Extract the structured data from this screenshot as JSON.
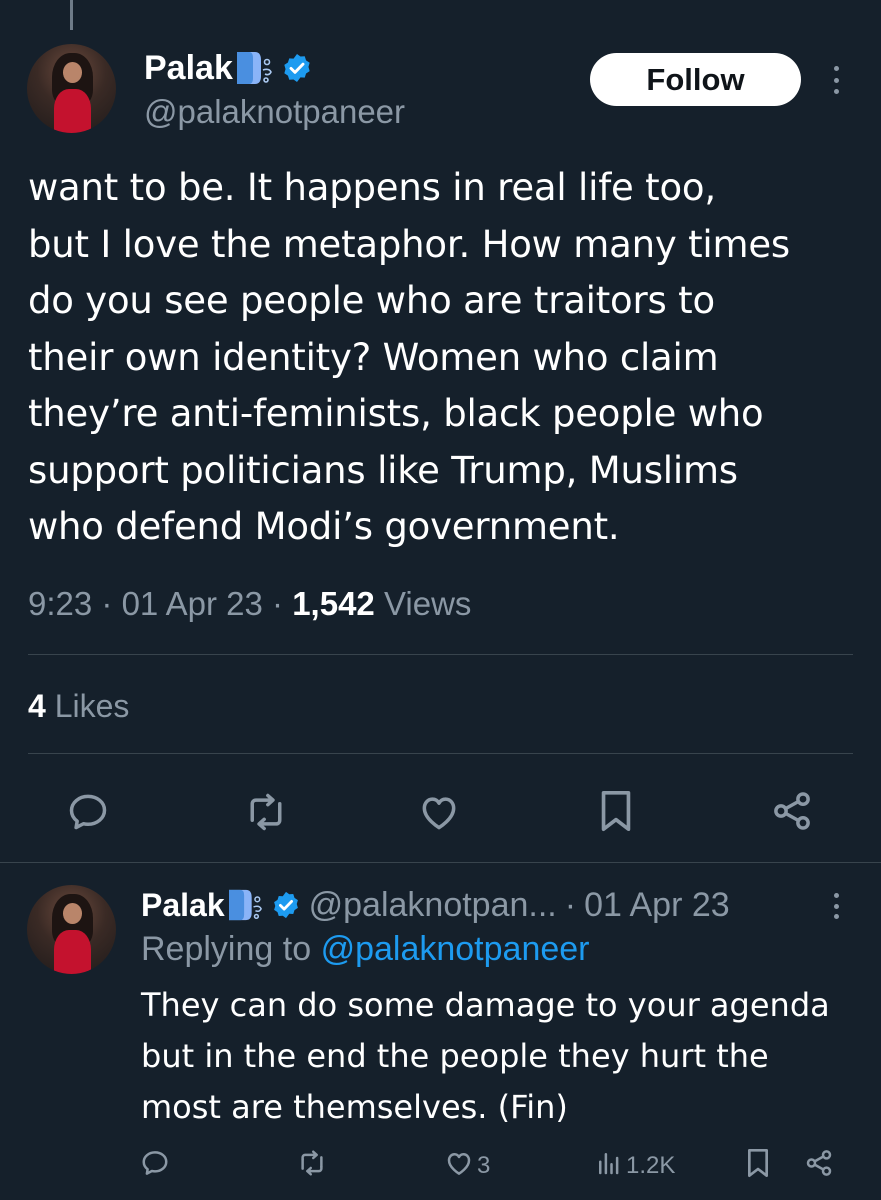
{
  "main_tweet": {
    "author": {
      "display_name": "Palak",
      "name_emoji": "face-exhaling-icon",
      "verified_icon": "verified-badge-icon",
      "handle": "@palaknotpaneer"
    },
    "follow_label": "Follow",
    "text": "want to be. It happens in real life too,\nbut I love the metaphor. How many times\ndo you see people who are traitors to\ntheir own identity? Women who claim\nthey’re anti-feminists, black people who\nsupport politicians like Trump, Muslims\nwho defend Modi’s government.",
    "time": "9:23",
    "date": "01 Apr 23",
    "separator": "·",
    "views_count": "1,542",
    "views_label": "Views",
    "likes_count": "4",
    "likes_label": "Likes",
    "actions": [
      "reply-icon",
      "retweet-icon",
      "like-icon",
      "bookmark-icon",
      "share-icon"
    ]
  },
  "reply_tweet": {
    "author": {
      "display_name": "Palak",
      "handle": "@palaknotpan...",
      "date": "01 Apr 23"
    },
    "replying_to_label": "Replying to",
    "replying_to_handle": "@palaknotpaneer",
    "text": "They can do some damage to your agenda\nbut in the end the people they hurt the\nmost are themselves. (Fin)",
    "like_count": "3",
    "views_count": "1.2K"
  },
  "colors": {
    "background": "#15202b",
    "text_primary": "#ffffff",
    "text_secondary": "#8b98a5",
    "accent": "#1d9bf0",
    "divider": "#38444d"
  }
}
